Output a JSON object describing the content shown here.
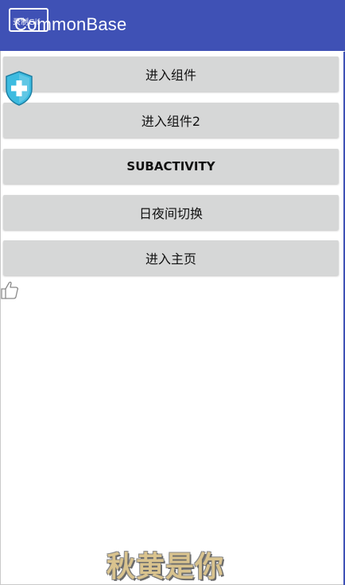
{
  "app": {
    "title": "CommonBase",
    "gif_badge": "录制Gif",
    "accent_color": "#3f51b5"
  },
  "buttons": [
    {
      "label": "进入组件"
    },
    {
      "label": "进入组件2"
    },
    {
      "label": "SUBACTIVITY"
    },
    {
      "label": "日夜间切换"
    },
    {
      "label": "进入主页"
    }
  ],
  "overlays": {
    "shield_icon": "shield-plus-icon",
    "thumb_icon": "thumbs-up-icon"
  },
  "footer": {
    "signature": "秋黄是你"
  }
}
